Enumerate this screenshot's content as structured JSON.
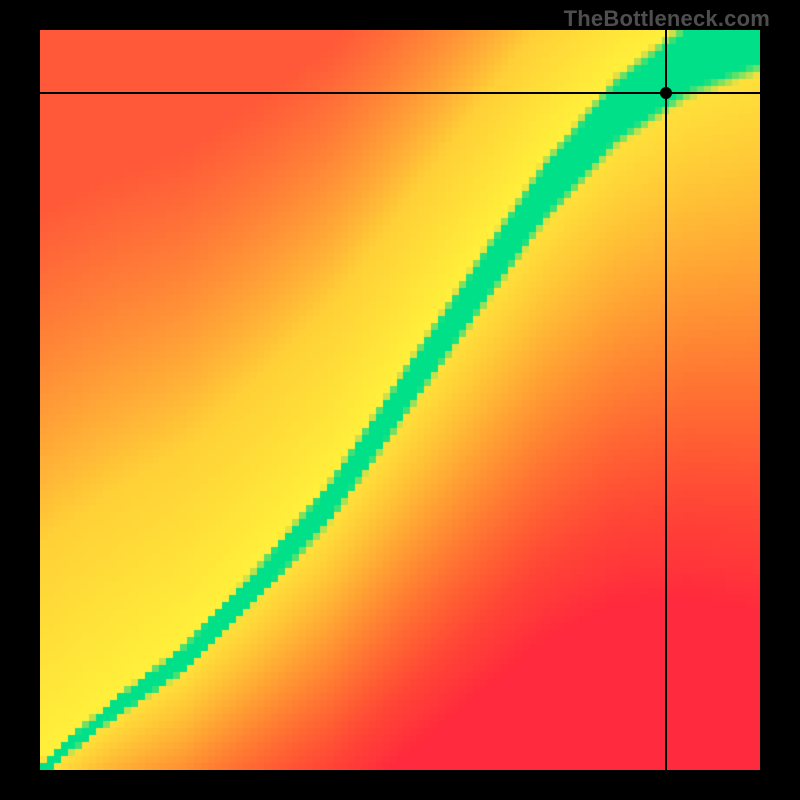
{
  "watermark": "TheBottleneck.com",
  "chart_data": {
    "type": "heatmap",
    "title": "",
    "xlabel": "",
    "ylabel": "",
    "xlim": [
      0,
      1
    ],
    "ylim": [
      0,
      1
    ],
    "marker": {
      "x": 0.87,
      "y": 0.915
    },
    "band_control_points": [
      {
        "x": 0.0,
        "y": 0.0,
        "width": 0.01
      },
      {
        "x": 0.1,
        "y": 0.08,
        "width": 0.015
      },
      {
        "x": 0.2,
        "y": 0.15,
        "width": 0.02
      },
      {
        "x": 0.3,
        "y": 0.25,
        "width": 0.025
      },
      {
        "x": 0.4,
        "y": 0.36,
        "width": 0.03
      },
      {
        "x": 0.5,
        "y": 0.5,
        "width": 0.035
      },
      {
        "x": 0.6,
        "y": 0.64,
        "width": 0.04
      },
      {
        "x": 0.7,
        "y": 0.78,
        "width": 0.045
      },
      {
        "x": 0.8,
        "y": 0.89,
        "width": 0.05
      },
      {
        "x": 0.9,
        "y": 0.96,
        "width": 0.055
      },
      {
        "x": 1.0,
        "y": 1.0,
        "width": 0.06
      }
    ],
    "colors": {
      "far_below": "#ff2a3d",
      "near": "#ffe03a",
      "on_band": "#00e089",
      "far_above": "#fff03a"
    }
  }
}
